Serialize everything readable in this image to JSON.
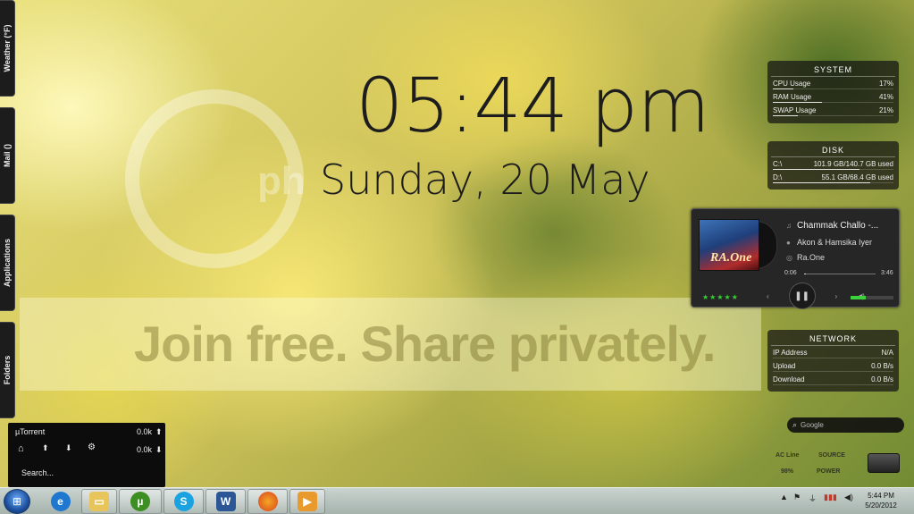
{
  "side_tabs": [
    "Weather (°F)",
    "Mail ()",
    "Applications",
    "Folders"
  ],
  "clock": {
    "time": "05:44 pm",
    "date": "Sunday, 20 May"
  },
  "watermark": {
    "text": "Join free. Share privately.",
    "logo_text": "ph"
  },
  "system": {
    "title": "SYSTEM",
    "rows": [
      {
        "label": "CPU Usage",
        "value": "17%",
        "level": 0.17
      },
      {
        "label": "RAM Usage",
        "value": "41%",
        "level": 0.41
      },
      {
        "label": "SWAP Usage",
        "value": "21%",
        "level": 0.21
      }
    ]
  },
  "disk": {
    "title": "DISK",
    "rows": [
      {
        "label": "C:\\",
        "value": "101.9 GB/140.7 GB used",
        "level": 0.72
      },
      {
        "label": "D:\\",
        "value": "55.1 GB/68.4 GB used",
        "level": 0.81
      }
    ]
  },
  "player": {
    "title": "Chammak Challo -...",
    "artist": "Akon & Hamsika Iyer",
    "album": "Ra.One",
    "cover_text": "RA.One",
    "elapsed": "0:06",
    "duration": "3:46",
    "progress": 0.03,
    "rating_stars": 5,
    "volume": 0.35
  },
  "network": {
    "title": "NETWORK",
    "rows": [
      {
        "label": "IP Address",
        "value": "N/A"
      },
      {
        "label": "Upload",
        "value": "0.0 B/s"
      },
      {
        "label": "Download",
        "value": "0.0 B/s"
      }
    ]
  },
  "search": {
    "placeholder": "Google"
  },
  "corner_info": {
    "ac": "AC Line",
    "pct": "98%",
    "source": "SOURCE",
    "power": "POWER"
  },
  "utorrent": {
    "title": "µTorrent",
    "up_rate": "0.0k",
    "down_rate": "0.0k",
    "search": "Search..."
  },
  "taskbar": {
    "apps": [
      "Internet Explorer",
      "Windows Explorer",
      "µTorrent",
      "Skype",
      "Microsoft Word",
      "Firefox",
      "Media Player"
    ],
    "clock_time": "5:44 PM",
    "clock_date": "5/20/2012"
  },
  "colors": {
    "panel_bg": "#141414",
    "accent_green": "#36d036",
    "taskbar": "#b4c0bb"
  }
}
